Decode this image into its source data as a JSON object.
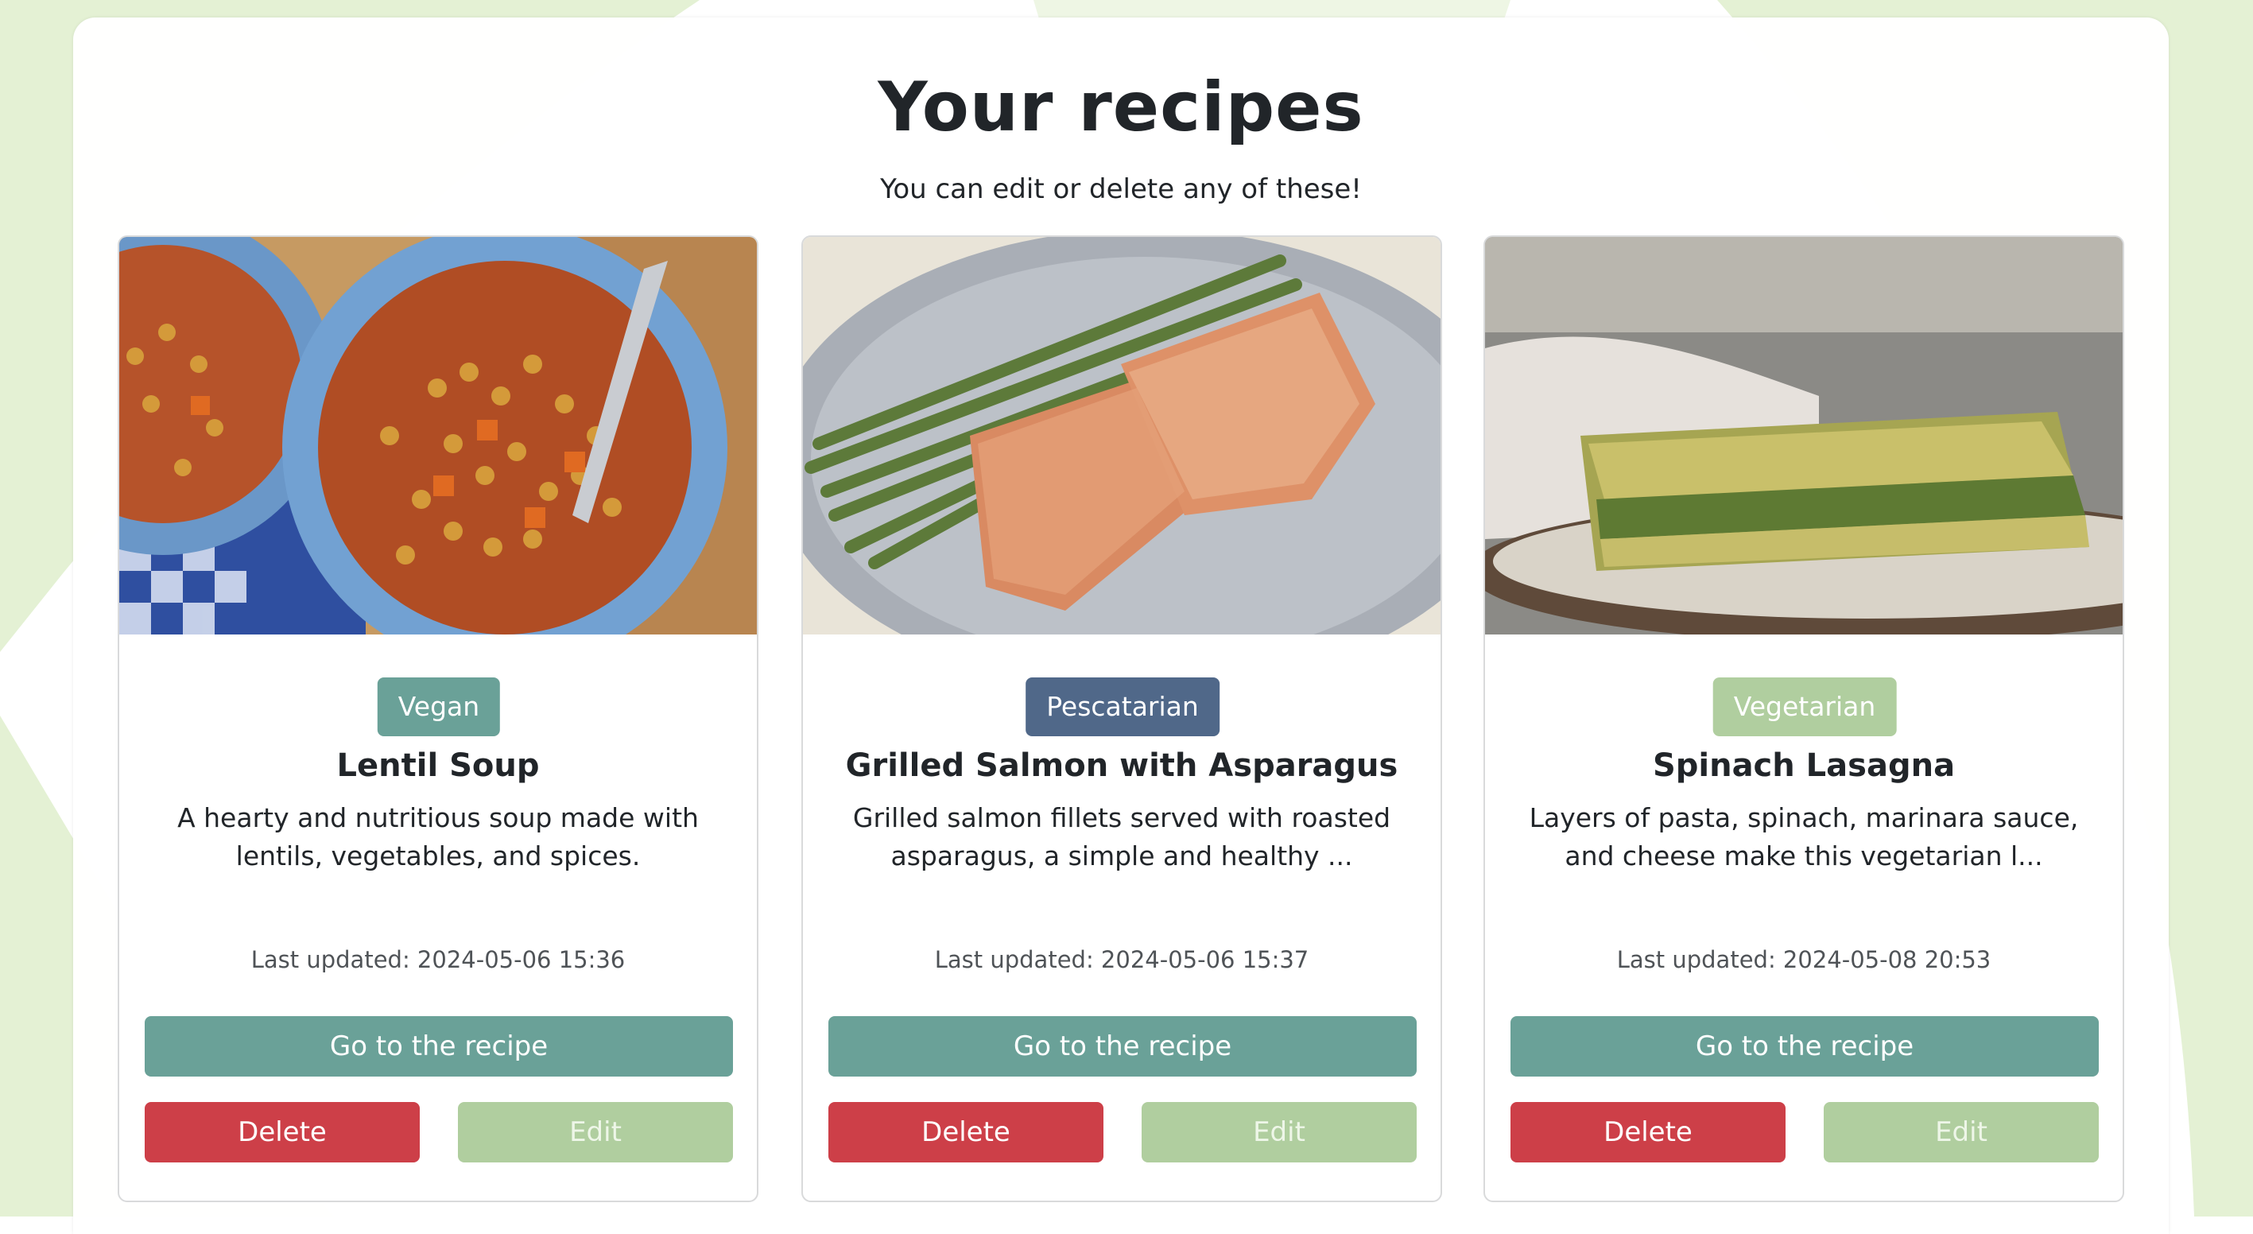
{
  "header": {
    "title": "Your recipes",
    "subtitle": "You can edit or delete any of these!"
  },
  "colors": {
    "background_accent": "#e4f1d4",
    "primary": "#6aa198",
    "danger": "#cd3f48",
    "edit": "#b0ce9f",
    "badge_vegan": "#6aa198",
    "badge_pescatarian": "#506889",
    "badge_vegetarian": "#b0ce9f"
  },
  "recipes": [
    {
      "badge": "Vegan",
      "title": "Lentil Soup",
      "description": "A hearty and nutritious soup made with lentils, vegetables, and spices.",
      "updated": "Last updated: 2024-05-06 15:36",
      "go_label": "Go to the recipe",
      "delete_label": "Delete",
      "edit_label": "Edit"
    },
    {
      "badge": "Pescatarian",
      "title": "Grilled Salmon with Asparagus",
      "description": "Grilled salmon fillets served with roasted asparagus, a simple and healthy ...",
      "updated": "Last updated: 2024-05-06 15:37",
      "go_label": "Go to the recipe",
      "delete_label": "Delete",
      "edit_label": "Edit"
    },
    {
      "badge": "Vegetarian",
      "title": "Spinach Lasagna",
      "description": "Layers of pasta, spinach, marinara sauce, and cheese make this vegetarian l...",
      "updated": "Last updated: 2024-05-08 20:53",
      "go_label": "Go to the recipe",
      "delete_label": "Delete",
      "edit_label": "Edit"
    }
  ]
}
